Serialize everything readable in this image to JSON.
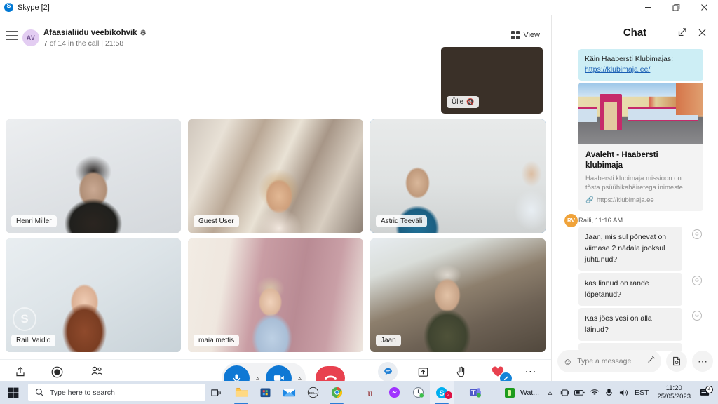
{
  "window": {
    "title": "Skype [2]",
    "minimize_label": "Minimize",
    "restore_label": "Restore",
    "close_label": "Close"
  },
  "call": {
    "group_initials": "AV",
    "group_title": "Afaasialiidu veebikohvik",
    "subtitle": "7 of 14 in the call | 21:58",
    "view_label": "View",
    "self_tile": {
      "name": "Ülle",
      "muted": true
    },
    "participants": [
      {
        "name": "Henri Miller",
        "active": false
      },
      {
        "name": "Guest User",
        "active": false
      },
      {
        "name": "Astrid Teeväli",
        "active": true
      },
      {
        "name": "Raili Vaidlo",
        "active": false
      },
      {
        "name": "maia mettis",
        "active": false
      },
      {
        "name": "Jaan",
        "active": false
      }
    ]
  },
  "toolbar": {
    "left": [
      {
        "label": "Invite",
        "icon": "share-icon"
      },
      {
        "label": "Record",
        "icon": "record-icon"
      },
      {
        "label": "Participants",
        "icon": "people-icon"
      }
    ],
    "right": [
      {
        "label": "Chat",
        "icon": "chat-icon"
      },
      {
        "label": "Share screen",
        "icon": "share-screen-icon"
      },
      {
        "label": "Raise Hand",
        "icon": "hand-icon"
      },
      {
        "label": "React",
        "icon": "heart-icon"
      },
      {
        "label": "More",
        "icon": "more-icon"
      }
    ],
    "mic_label": "Microphone",
    "camera_label": "Camera",
    "hangup_label": "End call"
  },
  "chat": {
    "title": "Chat",
    "expand_label": "Expand",
    "close_label": "Close",
    "outgoing": {
      "text": "Käin Haabersti Klubimajas:",
      "link": "https://klubimaja.ee/"
    },
    "link_card": {
      "title": "Avaleht - Haabersti klubimaja",
      "description": "Haabersti klubimaja missioon on tõsta psüühikahäiretega inimeste",
      "url": "https://klubimaja.ee"
    },
    "sender": "Raili, 11:16 AM",
    "sender_initials": "RV",
    "messages": [
      "Jaan, mis sul põnevat on viimase 2 nädala jooksul juhtunud?",
      "kas linnud on rände lõpetanud?",
      "Kas jões vesi on alla läinud?"
    ],
    "composer": {
      "placeholder": "Type a message",
      "emoji_label": "Emoji",
      "format_label": "Formatting",
      "attach_label": "Add files",
      "more_label": "More options"
    }
  },
  "taskbar": {
    "start_label": "Start",
    "search_placeholder": "Type here to search",
    "taskview_label": "Task view",
    "apps": [
      {
        "name": "file-explorer-icon",
        "open": true
      },
      {
        "name": "microsoft-store-icon",
        "open": false
      },
      {
        "name": "mail-icon",
        "open": false
      },
      {
        "name": "dell-icon",
        "open": false
      },
      {
        "name": "chrome-icon",
        "open": true
      },
      {
        "name": "u-app-icon",
        "open": false
      },
      {
        "name": "messenger-icon",
        "open": false
      },
      {
        "name": "clock-app-icon",
        "open": false
      },
      {
        "name": "skype-icon",
        "open": true,
        "badge": "2"
      },
      {
        "name": "teams-icon",
        "open": false
      }
    ],
    "tray_app_label": "Wat...",
    "locale": "EST",
    "time": "11:20",
    "date": "25/05/2023",
    "notification_count": "4"
  },
  "colors": {
    "accent": "#0f78d4",
    "hangup": "#e8414f",
    "outgoing_bubble": "#cdeef5",
    "incoming_bubble": "#f1f1f1",
    "taskbar": "#dbe3ee"
  }
}
